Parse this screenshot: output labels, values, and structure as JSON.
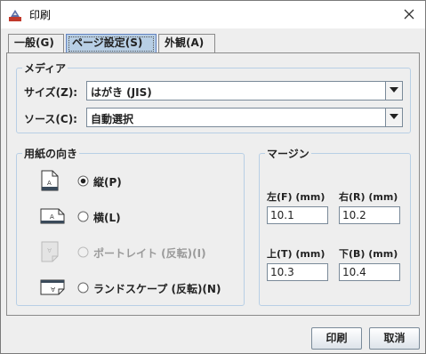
{
  "window": {
    "title": "印刷"
  },
  "tabs": [
    {
      "label": "一般(G)",
      "selected": false
    },
    {
      "label": "ページ設定(S)",
      "selected": true
    },
    {
      "label": "外観(A)",
      "selected": false
    }
  ],
  "media": {
    "group_title": "メディア",
    "size_label": "サイズ(Z):",
    "size_value": "はがき (JIS)",
    "source_label": "ソース(C):",
    "source_value": "自動選択"
  },
  "orientation": {
    "group_title": "用紙の向き",
    "options": [
      {
        "label": "縦(P)",
        "selected": true,
        "enabled": true,
        "icon": "portrait-icon"
      },
      {
        "label": "横(L)",
        "selected": false,
        "enabled": true,
        "icon": "landscape-icon"
      },
      {
        "label": "ポートレイト (反転)(I)",
        "selected": false,
        "enabled": false,
        "icon": "reverse-portrait-icon"
      },
      {
        "label": "ランドスケープ (反転)(N)",
        "selected": false,
        "enabled": true,
        "icon": "reverse-landscape-icon"
      }
    ]
  },
  "margins": {
    "group_title": "マージン",
    "left_label": "左(F) (mm)",
    "left_value": "10.1",
    "right_label": "右(R) (mm)",
    "right_value": "10.2",
    "top_label": "上(T) (mm)",
    "top_value": "10.3",
    "bottom_label": "下(B) (mm)",
    "bottom_value": "10.4"
  },
  "buttons": {
    "print": "印刷",
    "cancel": "取消"
  },
  "colors": {
    "accent": "#b8cfe5",
    "tab_selected": "#b8cfe5",
    "border": "#7a8a99"
  }
}
